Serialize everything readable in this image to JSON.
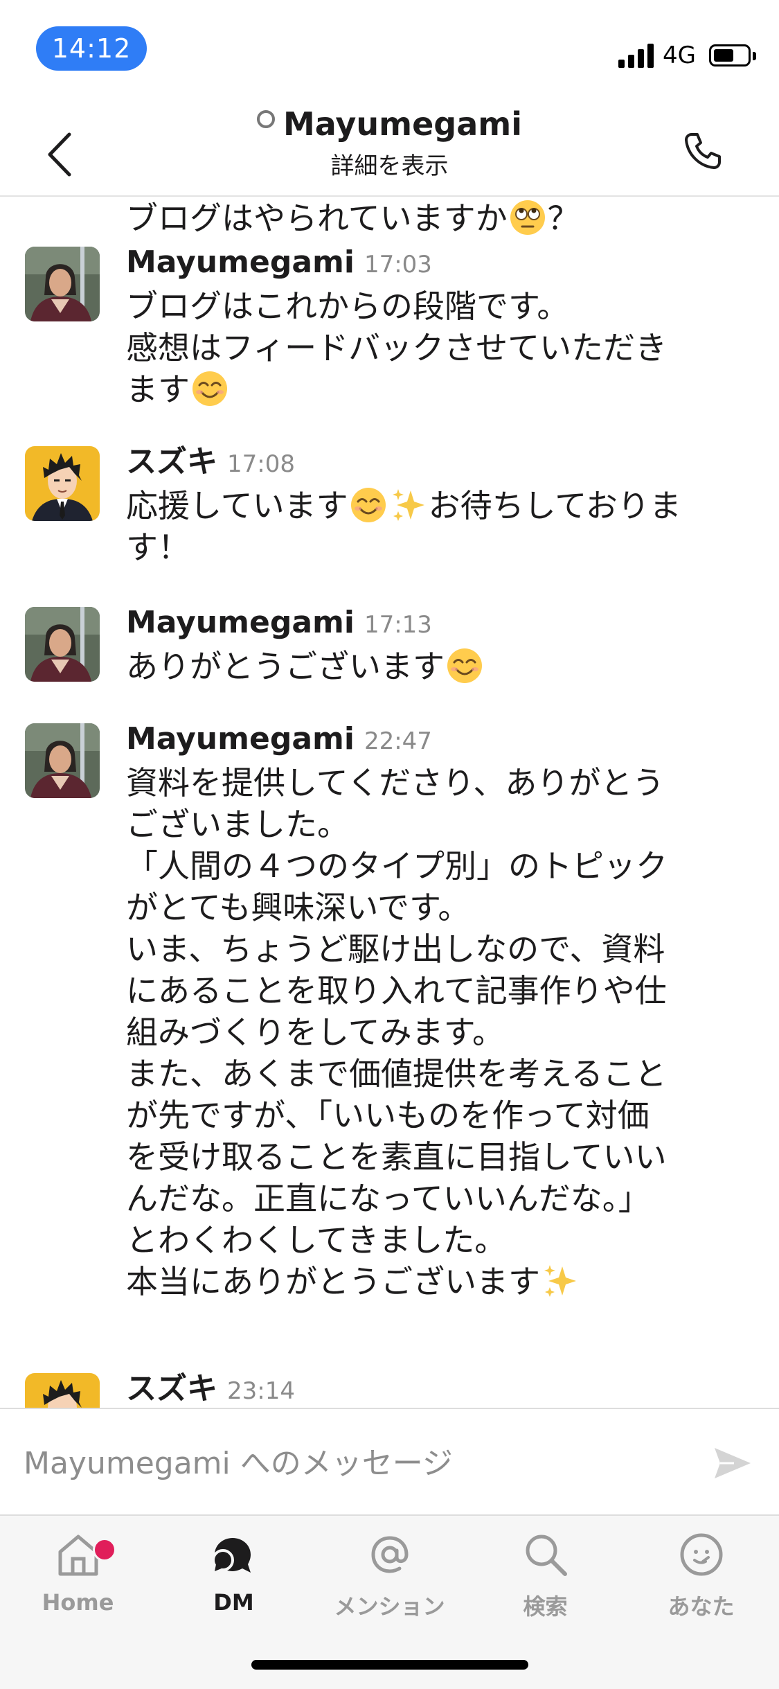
{
  "status_bar": {
    "time": "14:12",
    "network": "4G"
  },
  "header": {
    "contact_name": "Mayumegami",
    "subtitle": "詳細を表示"
  },
  "messages": {
    "continuation": {
      "text": "ブログはやられていますか",
      "suffix": "？"
    },
    "items": [
      {
        "sender": "Mayumegami",
        "time": "17:03",
        "lines": [
          "ブログはこれからの段階です。",
          "感想はフィードバックさせていただき",
          "ます"
        ]
      },
      {
        "sender": "スズキ",
        "time": "17:08",
        "lines": [
          "応援しています",
          "お待ちしておりま",
          "す！"
        ]
      },
      {
        "sender": "Mayumegami",
        "time": "17:13",
        "lines": [
          "ありがとうございます"
        ]
      },
      {
        "sender": "Mayumegami",
        "time": "22:47",
        "lines": [
          "資料を提供してくださり、ありがとう",
          "ございました。",
          "「人間の４つのタイプ別」のトピック",
          "がとても興味深いです。",
          "いま、ちょうど駆け出しなので、資料",
          "にあることを取り入れて記事作りや仕",
          "組みづくりをしてみます。",
          "また、あくまで価値提供を考えること",
          "が先ですが、「いいものを作って対価",
          "を受け取ることを素直に目指していい",
          "んだな。正直になっていいんだな。」",
          "とわくわくしてきました。",
          "本当にありがとうございます"
        ]
      },
      {
        "sender": "スズキ",
        "time": "23:14"
      }
    ]
  },
  "composer": {
    "placeholder": "Mayumegami へのメッセージ"
  },
  "tabs": [
    {
      "label": "Home",
      "icon": "home-icon",
      "badge": true
    },
    {
      "label": "DM",
      "icon": "dm-icon",
      "active": true
    },
    {
      "label": "メンション",
      "icon": "at-icon"
    },
    {
      "label": "検索",
      "icon": "search-icon"
    },
    {
      "label": "あなた",
      "icon": "profile-icon"
    }
  ],
  "colors": {
    "time_pill": "#2f7df6",
    "badge": "#e01e5a",
    "sparkle": "#f7c948",
    "smile": "#ffcc4d"
  },
  "icons": {
    "header": [
      "back-icon",
      "presence-icon",
      "phone-icon"
    ],
    "emoji": [
      "eye-roll-emoji",
      "smile-emoji",
      "sparkles-emoji"
    ],
    "composer": [
      "send-icon"
    ]
  }
}
